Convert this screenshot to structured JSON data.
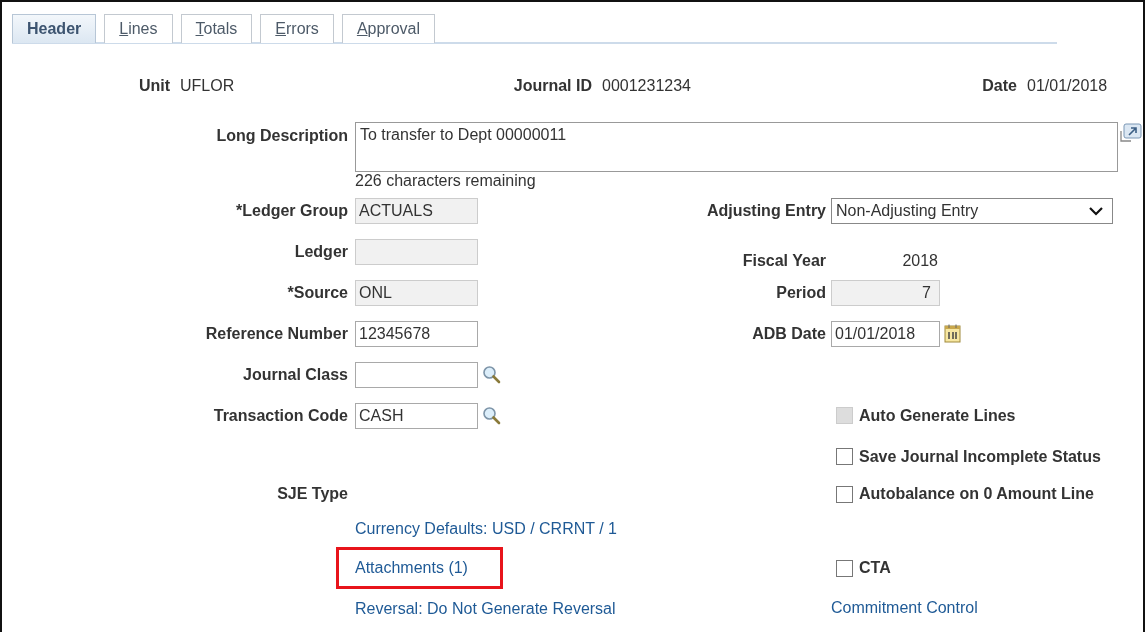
{
  "tabs": [
    {
      "label": "Header",
      "selected": true,
      "hotkey": false
    },
    {
      "label": "Lines",
      "selected": false,
      "hotkey": true
    },
    {
      "label": "Totals",
      "selected": false,
      "hotkey": true
    },
    {
      "label": "Errors",
      "selected": false,
      "hotkey": true
    },
    {
      "label": "Approval",
      "selected": false,
      "hotkey": true
    }
  ],
  "header_info": [
    {
      "label": "Unit",
      "value": "UFLOR"
    },
    {
      "label": "Journal ID",
      "value": "0001231234"
    },
    {
      "label": "Date",
      "value": "01/01/2018"
    }
  ],
  "long_description": {
    "label": "Long Description",
    "value": "To transfer to Dept 00000011",
    "counter": "226 characters remaining"
  },
  "rows": [
    {
      "left": {
        "kind": "input",
        "label": "*Ledger Group",
        "value": "ACTUALS",
        "disabled": true
      },
      "right": {
        "kind": "select",
        "label": "Adjusting Entry",
        "value": "Non-Adjusting Entry"
      }
    },
    {
      "left": {
        "kind": "input",
        "label": "Ledger",
        "disabled": true
      },
      "right": {
        "kind": "display",
        "label": "Fiscal Year",
        "value": "2018"
      }
    },
    {
      "left": {
        "kind": "input",
        "label": "*Source",
        "value": "ONL",
        "disabled": true
      },
      "right": {
        "kind": "number",
        "label": "Period",
        "value": "7",
        "disabled": true
      }
    },
    {
      "left": {
        "kind": "input",
        "label": "Reference Number",
        "value": "12345678",
        "disabled": false
      },
      "right": {
        "kind": "date",
        "label": "ADB Date",
        "value": "01/01/2018",
        "disabled": false
      }
    },
    {
      "left": {
        "kind": "lookup",
        "label": "Journal Class",
        "disabled": false
      }
    },
    {
      "left": {
        "kind": "lookup",
        "label": "Transaction Code",
        "value": "CASH",
        "disabled": false
      },
      "right": {
        "kind": "checkbox",
        "label": "Auto Generate Lines",
        "checked": false,
        "disabled": true
      }
    },
    {
      "right": {
        "kind": "checkbox",
        "label": "Save Journal Incomplete Status",
        "checked": false,
        "disabled": false
      }
    },
    {
      "left": {
        "kind": "text",
        "label": "SJE Type"
      },
      "right": {
        "kind": "checkbox",
        "label": "Autobalance on 0 Amount Line",
        "checked": false,
        "disabled": false
      }
    },
    {
      "left": {
        "kind": "link",
        "label": "Currency Defaults: USD / CRRNT / 1",
        "highlighted": false
      }
    },
    {
      "left": {
        "kind": "link",
        "label": "Attachments (1)",
        "highlighted": true
      },
      "right": {
        "kind": "checkbox",
        "label": "CTA",
        "checked": false,
        "disabled": false
      }
    },
    {
      "left": {
        "kind": "link",
        "label": "Reversal: Do Not Generate Reversal",
        "highlighted": false
      },
      "right": {
        "kind": "link",
        "label": "Commitment Control",
        "highlighted": false
      }
    }
  ]
}
